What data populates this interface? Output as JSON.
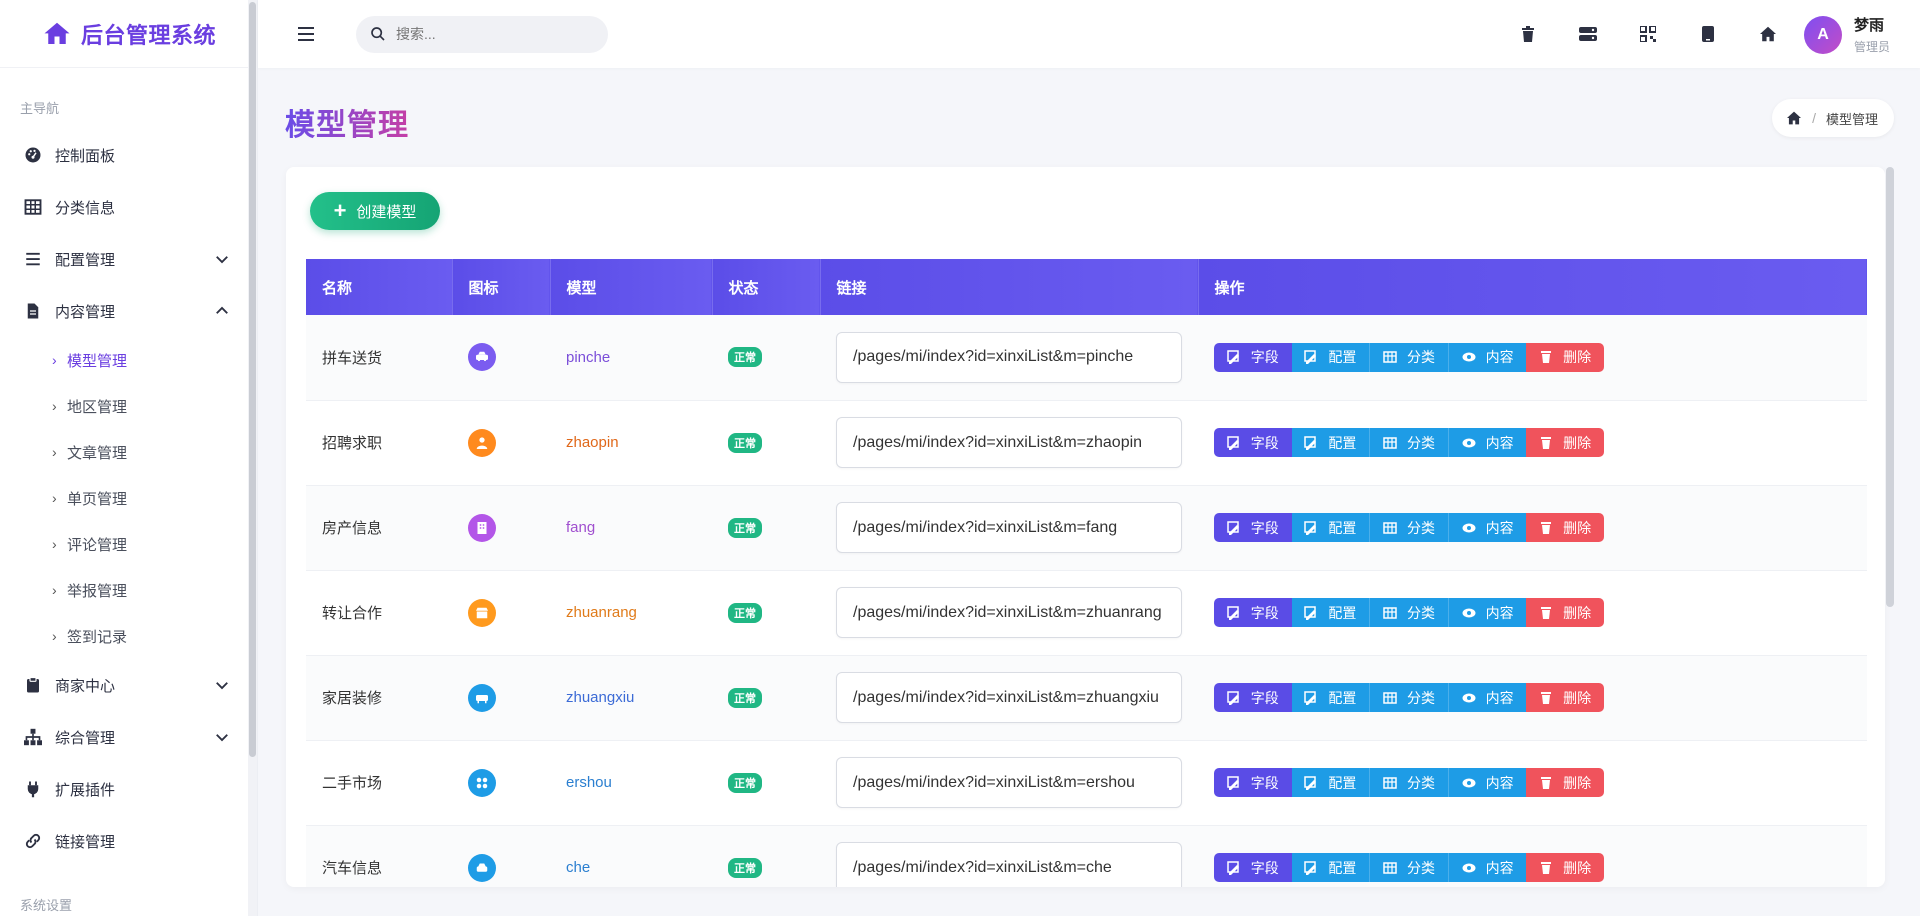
{
  "brand": {
    "title": "后台管理系统"
  },
  "sidebar": {
    "main_caption": "主导航",
    "items": [
      {
        "label": "控制面板",
        "icon": "dashboard-icon"
      },
      {
        "label": "分类信息",
        "icon": "table-icon"
      },
      {
        "label": "配置管理",
        "icon": "list-icon"
      },
      {
        "label": "内容管理",
        "icon": "document-icon"
      }
    ],
    "sub_items": [
      "模型管理",
      "地区管理",
      "文章管理",
      "单页管理",
      "评论管理",
      "举报管理",
      "签到记录"
    ],
    "items2": [
      {
        "label": "商家中心",
        "icon": "clipboard-icon"
      },
      {
        "label": "综合管理",
        "icon": "sitemap-icon"
      },
      {
        "label": "扩展插件",
        "icon": "plug-icon"
      },
      {
        "label": "链接管理",
        "icon": "link-icon"
      }
    ],
    "settings_caption": "系统设置"
  },
  "header": {
    "search_placeholder": "搜索...",
    "icons": [
      "trash-icon",
      "server-icon",
      "qrcode-icon",
      "mobile-icon",
      "home-icon"
    ],
    "user": {
      "initial": "A",
      "name": "梦雨",
      "role": "管理员"
    }
  },
  "page": {
    "title": "模型管理",
    "breadcrumb": "模型管理",
    "create_label": "创建模型"
  },
  "table": {
    "columns": [
      "名称",
      "图标",
      "模型",
      "状态",
      "链接",
      "操作"
    ],
    "actions": [
      "字段",
      "配置",
      "分类",
      "内容",
      "删除"
    ],
    "rows": [
      {
        "name": "拼车送货",
        "code": "pinche",
        "status": "正常",
        "link": "/pages/mi/index?id=xinxiList&m=pinche",
        "color": "#7b5cf0",
        "code_color": "#7b4fd9"
      },
      {
        "name": "招聘求职",
        "code": "zhaopin",
        "status": "正常",
        "link": "/pages/mi/index?id=xinxiList&m=zhaopin",
        "color": "#ff8a1e",
        "code_color": "#e0681a"
      },
      {
        "name": "房产信息",
        "code": "fang",
        "status": "正常",
        "link": "/pages/mi/index?id=xinxiList&m=fang",
        "color": "#b356e8",
        "code_color": "#a04fcf"
      },
      {
        "name": "转让合作",
        "code": "zhuanrang",
        "status": "正常",
        "link": "/pages/mi/index?id=xinxiList&m=zhuanrang",
        "color": "#ff9a1e",
        "code_color": "#e07b1a"
      },
      {
        "name": "家居装修",
        "code": "zhuangxiu",
        "status": "正常",
        "link": "/pages/mi/index?id=xinxiList&m=zhuangxiu",
        "color": "#1e9ce6",
        "code_color": "#3c6bd6"
      },
      {
        "name": "二手市场",
        "code": "ershou",
        "status": "正常",
        "link": "/pages/mi/index?id=xinxiList&m=ershou",
        "color": "#1e9ce6",
        "code_color": "#2b7fd0"
      },
      {
        "name": "汽车信息",
        "code": "che",
        "status": "正常",
        "link": "/pages/mi/index?id=xinxiList&m=che",
        "color": "#1e9ce6",
        "code_color": "#2b7fd0"
      }
    ]
  }
}
